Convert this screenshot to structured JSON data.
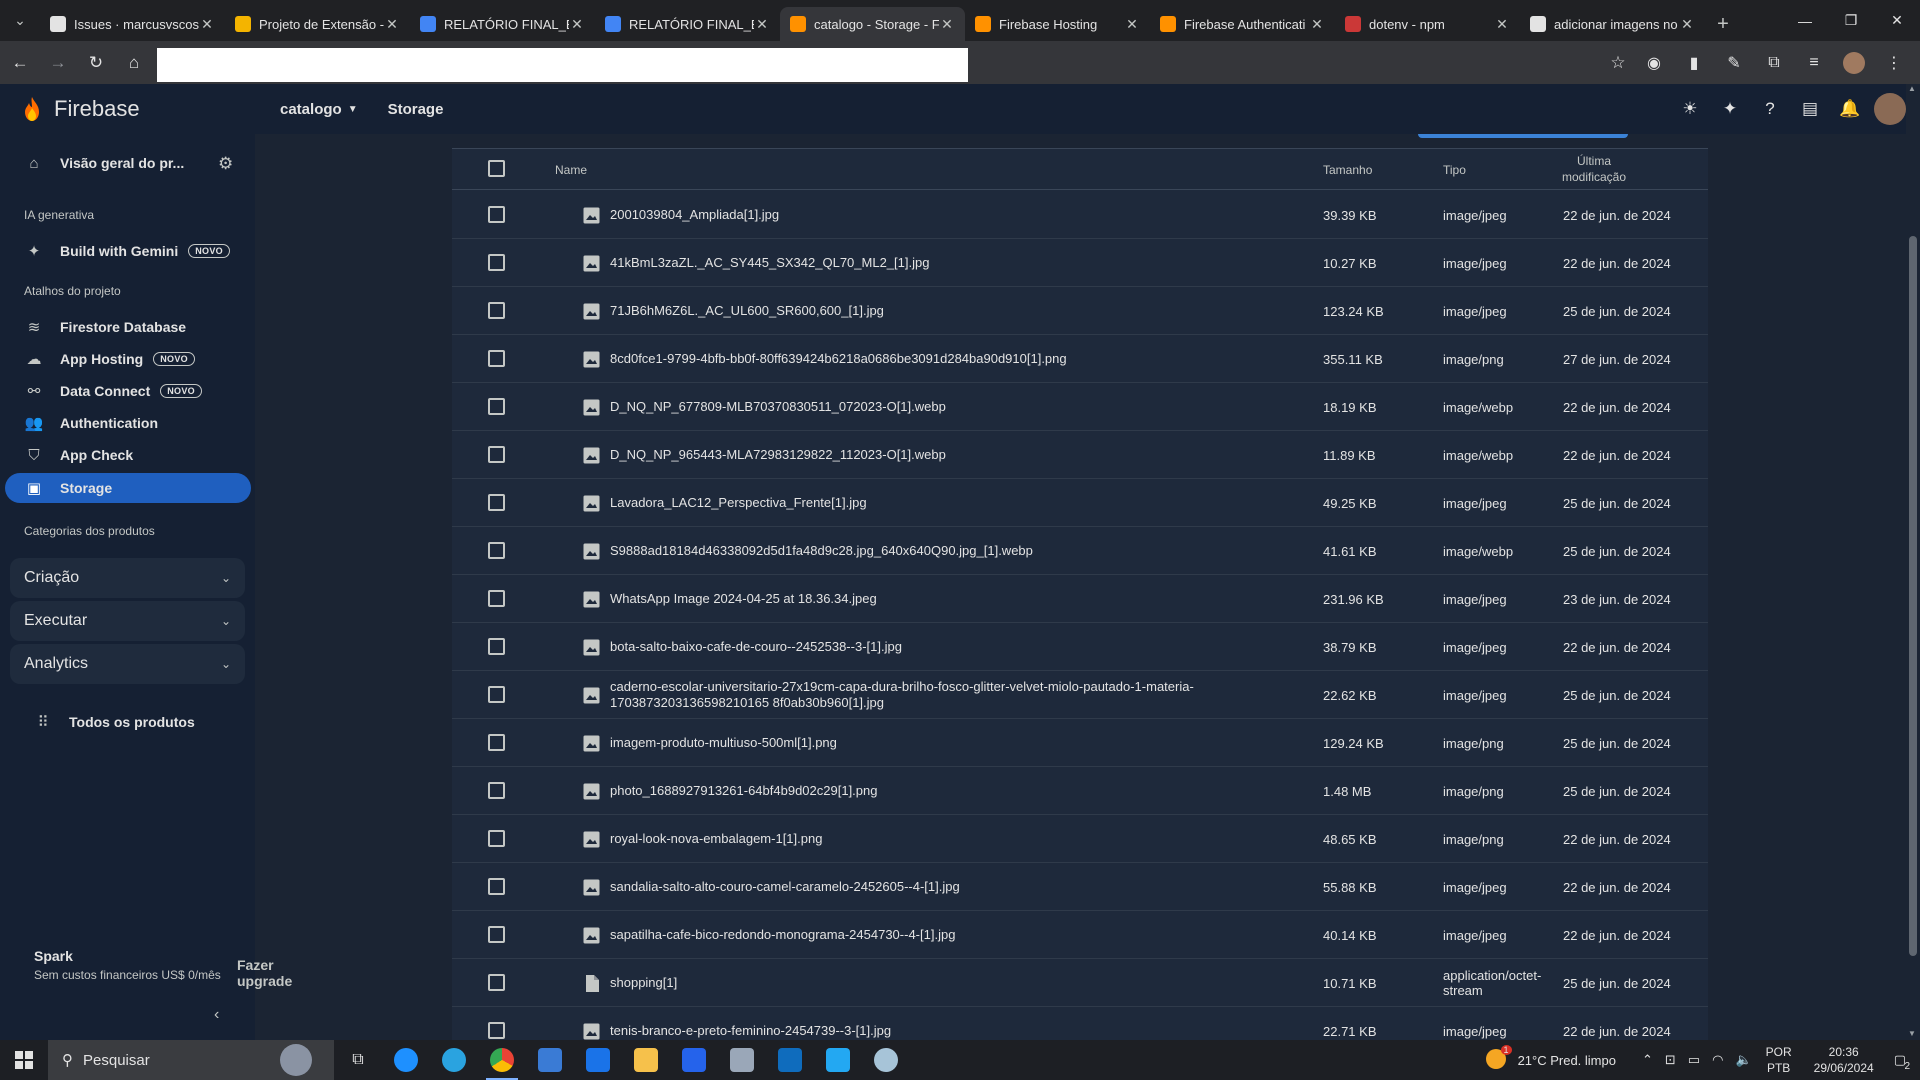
{
  "browser": {
    "tabs": [
      {
        "title": "Issues · marcusvscost",
        "icon_color": "#e3e3e3",
        "active": false
      },
      {
        "title": "Projeto de Extensão -",
        "icon_color": "#f4b400",
        "active": false
      },
      {
        "title": "RELATÓRIO FINAL_EN",
        "icon_color": "#4285f4",
        "active": false
      },
      {
        "title": "RELATÓRIO FINAL_EN",
        "icon_color": "#4285f4",
        "active": false
      },
      {
        "title": "catalogo - Storage - F",
        "icon_color": "#ff9100",
        "active": true
      },
      {
        "title": "Firebase Hosting",
        "icon_color": "#ff9100",
        "active": false
      },
      {
        "title": "Firebase Authenticati",
        "icon_color": "#ff9100",
        "active": false
      },
      {
        "title": "dotenv - npm",
        "icon_color": "#cb3837",
        "active": false
      },
      {
        "title": "adicionar imagens no",
        "icon_color": "#e3e3e3",
        "active": false
      }
    ]
  },
  "sidebar": {
    "brand": "Firebase",
    "overview": "Visão geral do pr...",
    "section_ai": "IA generativa",
    "gemini": "Build with Gemini",
    "badge_new": "NOVO",
    "section_shortcuts": "Atalhos do projeto",
    "items": [
      {
        "label": "Firestore Database",
        "badge": ""
      },
      {
        "label": "App Hosting",
        "badge": "NOVO"
      },
      {
        "label": "Data Connect",
        "badge": "NOVO"
      },
      {
        "label": "Authentication",
        "badge": ""
      },
      {
        "label": "App Check",
        "badge": ""
      },
      {
        "label": "Storage",
        "badge": ""
      }
    ],
    "section_categories": "Categorias dos produtos",
    "accordions": [
      "Criação",
      "Executar",
      "Analytics"
    ],
    "all_products": "Todos os produtos",
    "plan_name": "Spark",
    "plan_desc": "Sem custos financeiros US$ 0/mês",
    "upgrade": "Fazer upgrade"
  },
  "topbar": {
    "project": "catalogo",
    "breadcrumb": "Storage"
  },
  "table": {
    "headers": {
      "name": "Name",
      "size": "Tamanho",
      "type": "Tipo",
      "modified": "Última modificação"
    },
    "rows": [
      {
        "name": "2001039804_Ampliada[1].jpg",
        "size": "39.39 KB",
        "type": "image/jpeg",
        "date": "22 de jun. de 2024",
        "kind": "image"
      },
      {
        "name": "41kBmL3zaZL._AC_SY445_SX342_QL70_ML2_[1].jpg",
        "size": "10.27 KB",
        "type": "image/jpeg",
        "date": "22 de jun. de 2024",
        "kind": "image"
      },
      {
        "name": "71JB6hM6Z6L._AC_UL600_SR600,600_[1].jpg",
        "size": "123.24 KB",
        "type": "image/jpeg",
        "date": "25 de jun. de 2024",
        "kind": "image"
      },
      {
        "name": "8cd0fce1-9799-4bfb-bb0f-80ff639424b6218a0686be3091d284ba90d910[1].png",
        "size": "355.11 KB",
        "type": "image/png",
        "date": "27 de jun. de 2024",
        "kind": "image"
      },
      {
        "name": "D_NQ_NP_677809-MLB70370830511_072023-O[1].webp",
        "size": "18.19 KB",
        "type": "image/webp",
        "date": "22 de jun. de 2024",
        "kind": "image"
      },
      {
        "name": "D_NQ_NP_965443-MLA72983129822_112023-O[1].webp",
        "size": "11.89 KB",
        "type": "image/webp",
        "date": "22 de jun. de 2024",
        "kind": "image"
      },
      {
        "name": "Lavadora_LAC12_Perspectiva_Frente[1].jpg",
        "size": "49.25 KB",
        "type": "image/jpeg",
        "date": "25 de jun. de 2024",
        "kind": "image"
      },
      {
        "name": "S9888ad18184d46338092d5d1fa48d9c28.jpg_640x640Q90.jpg_[1].webp",
        "size": "41.61 KB",
        "type": "image/webp",
        "date": "25 de jun. de 2024",
        "kind": "image"
      },
      {
        "name": "WhatsApp Image 2024-04-25 at 18.36.34.jpeg",
        "size": "231.96 KB",
        "type": "image/jpeg",
        "date": "23 de jun. de 2024",
        "kind": "image"
      },
      {
        "name": "bota-salto-baixo-cafe-de-couro--2452538--3-[1].jpg",
        "size": "38.79 KB",
        "type": "image/jpeg",
        "date": "22 de jun. de 2024",
        "kind": "image"
      },
      {
        "name": "caderno-escolar-universitario-27x19cm-capa-dura-brilho-fosco-glitter-velvet-miolo-pautado-1-materia-1703873203136598210165 8f0ab30b960[1].jpg",
        "size": "22.62 KB",
        "type": "image/jpeg",
        "date": "25 de jun. de 2024",
        "kind": "image"
      },
      {
        "name": "imagem-produto-multiuso-500ml[1].png",
        "size": "129.24 KB",
        "type": "image/png",
        "date": "25 de jun. de 2024",
        "kind": "image"
      },
      {
        "name": "photo_1688927913261-64bf4b9d02c29[1].png",
        "size": "1.48 MB",
        "type": "image/png",
        "date": "25 de jun. de 2024",
        "kind": "image"
      },
      {
        "name": "royal-look-nova-embalagem-1[1].png",
        "size": "48.65 KB",
        "type": "image/png",
        "date": "22 de jun. de 2024",
        "kind": "image"
      },
      {
        "name": "sandalia-salto-alto-couro-camel-caramelo-2452605--4-[1].jpg",
        "size": "55.88 KB",
        "type": "image/jpeg",
        "date": "22 de jun. de 2024",
        "kind": "image"
      },
      {
        "name": "sapatilha-cafe-bico-redondo-monograma-2454730--4-[1].jpg",
        "size": "40.14 KB",
        "type": "image/jpeg",
        "date": "22 de jun. de 2024",
        "kind": "image"
      },
      {
        "name": "shopping[1]",
        "size": "10.71 KB",
        "type": "application/octet-stream",
        "date": "25 de jun. de 2024",
        "kind": "file"
      },
      {
        "name": "tenis-branco-e-preto-feminino-2454739--3-[1].jpg",
        "size": "22.71 KB",
        "type": "image/jpeg",
        "date": "22 de jun. de 2024",
        "kind": "image"
      }
    ]
  },
  "taskbar": {
    "search_placeholder": "Pesquisar",
    "weather": "21°C  Pred. limpo",
    "lang_top": "POR",
    "lang_bottom": "PTB",
    "time": "20:36",
    "date": "29/06/2024",
    "notif_count": "2",
    "weather_badge": "1"
  }
}
